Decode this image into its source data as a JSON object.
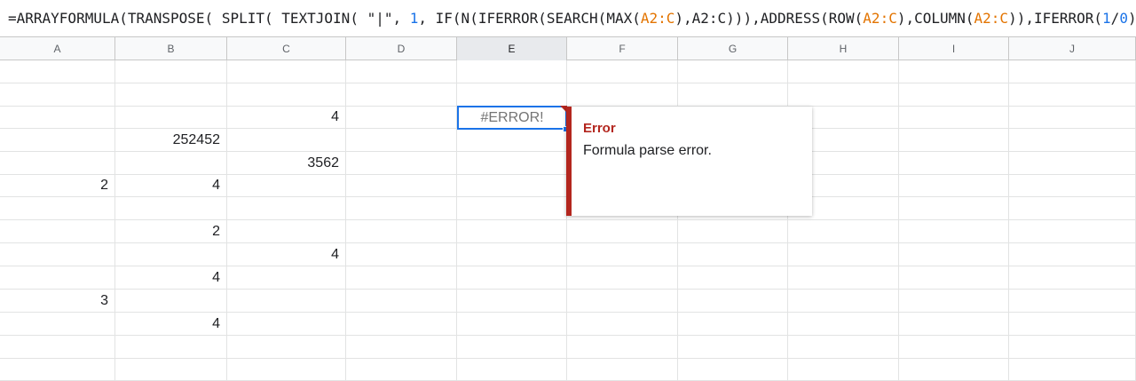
{
  "formula": {
    "parts": [
      {
        "text": "=ARRAYFORMULA(TRANSPOSE( SPLIT( TEXTJOIN( \"|\", ",
        "kind": "plain"
      },
      {
        "text": "1",
        "kind": "num"
      },
      {
        "text": ", IF(N(IFERROR(SEARCH(MAX(",
        "kind": "plain"
      },
      {
        "text": "A2:C",
        "kind": "ref"
      },
      {
        "text": "),A2:C))),ADDRESS(ROW(",
        "kind": "plain"
      },
      {
        "text": "A2:C",
        "kind": "ref"
      },
      {
        "text": "),COLUMN(",
        "kind": "plain"
      },
      {
        "text": "A2:C",
        "kind": "ref"
      },
      {
        "text": ")),IFERROR(",
        "kind": "plain"
      },
      {
        "text": "1",
        "kind": "num"
      },
      {
        "text": "/",
        "kind": "plain"
      },
      {
        "text": "0",
        "kind": "num"
      },
      {
        "text": ")) ) ,\"|\" ) ))",
        "kind": "plain"
      }
    ]
  },
  "columns": [
    "A",
    "B",
    "C",
    "D",
    "E",
    "F",
    "G",
    "H",
    "I",
    "J"
  ],
  "active_column": "E",
  "cells": [
    {
      "col": "C",
      "row": 3,
      "value": "4"
    },
    {
      "col": "B",
      "row": 4,
      "value": "252452"
    },
    {
      "col": "C",
      "row": 5,
      "value": "3562"
    },
    {
      "col": "A",
      "row": 6,
      "value": "2"
    },
    {
      "col": "B",
      "row": 6,
      "value": "4"
    },
    {
      "col": "B",
      "row": 8,
      "value": "2"
    },
    {
      "col": "C",
      "row": 9,
      "value": "4"
    },
    {
      "col": "B",
      "row": 10,
      "value": "4"
    },
    {
      "col": "A",
      "row": 11,
      "value": "3"
    },
    {
      "col": "B",
      "row": 12,
      "value": "4"
    }
  ],
  "selected_cell": {
    "ref": "E3",
    "value": "#ERROR!"
  },
  "error_tooltip": {
    "title": "Error",
    "message": "Formula parse error."
  },
  "colors": {
    "selection": "#1a73e8",
    "error": "#b3261e",
    "range_ref": "#e37400",
    "number": "#1a73e8"
  }
}
